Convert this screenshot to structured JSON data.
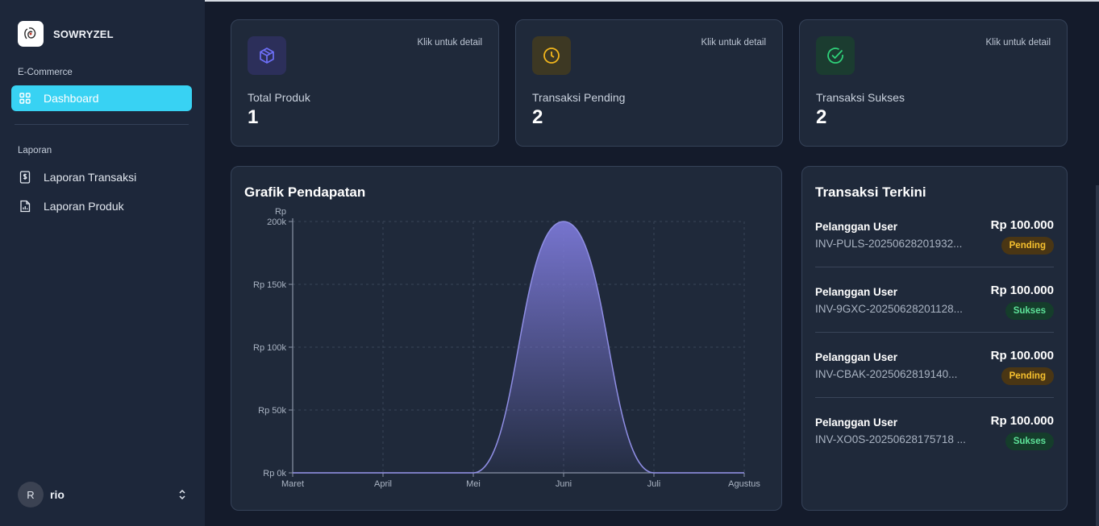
{
  "brand": {
    "name": "SOWRYZEL"
  },
  "sidebar": {
    "sections": [
      {
        "label": "E-Commerce"
      },
      {
        "label": "Laporan"
      }
    ],
    "items": [
      {
        "label": "Dashboard",
        "icon": "grid-icon",
        "active": true
      },
      {
        "label": "Laporan Transaksi",
        "icon": "dollar-doc-icon",
        "active": false
      },
      {
        "label": "Laporan Produk",
        "icon": "chart-doc-icon",
        "active": false
      }
    ],
    "user": {
      "initial": "R",
      "name": "rio"
    }
  },
  "stats": [
    {
      "hint": "Klik untuk detail",
      "label": "Total Produk",
      "value": "1",
      "icon": "box-icon",
      "color": "#6d6ff7"
    },
    {
      "hint": "Klik untuk detail",
      "label": "Transaksi Pending",
      "value": "2",
      "icon": "clock-icon",
      "color": "#f2b61c"
    },
    {
      "hint": "Klik untuk detail",
      "label": "Transaksi Sukses",
      "value": "2",
      "icon": "check-circle-icon",
      "color": "#2fd27a"
    }
  ],
  "chart": {
    "title": "Grafik Pendapatan"
  },
  "chart_data": {
    "type": "area",
    "title": "Grafik Pendapatan",
    "categories": [
      "Maret",
      "April",
      "Mei",
      "Juni",
      "Juli",
      "Agustus"
    ],
    "y_tick_labels": [
      "Rp 0k",
      "Rp 50k",
      "Rp 100k",
      "Rp 150k",
      "Rp 200k"
    ],
    "y_ticks": [
      0,
      50000,
      100000,
      150000,
      200000
    ],
    "values": [
      0,
      0,
      0,
      200000,
      0,
      0
    ],
    "ylim": [
      0,
      200000
    ],
    "grid": true,
    "colors": {
      "line": "#8f8ee4",
      "fill": "#7b78d6"
    }
  },
  "transactions": {
    "title": "Transaksi Terkini",
    "items": [
      {
        "customer": "Pelanggan User",
        "invoice": "INV-PULS-20250628201932...",
        "amount": "Rp 100.000",
        "status": "Pending"
      },
      {
        "customer": "Pelanggan User",
        "invoice": "INV-9GXC-20250628201128...",
        "amount": "Rp 100.000",
        "status": "Sukses"
      },
      {
        "customer": "Pelanggan User",
        "invoice": "INV-CBAK-2025062819140...",
        "amount": "Rp 100.000",
        "status": "Pending"
      },
      {
        "customer": "Pelanggan User",
        "invoice": "INV-XO0S-20250628175718 ...",
        "amount": "Rp 100.000",
        "status": "Sukses"
      }
    ]
  }
}
